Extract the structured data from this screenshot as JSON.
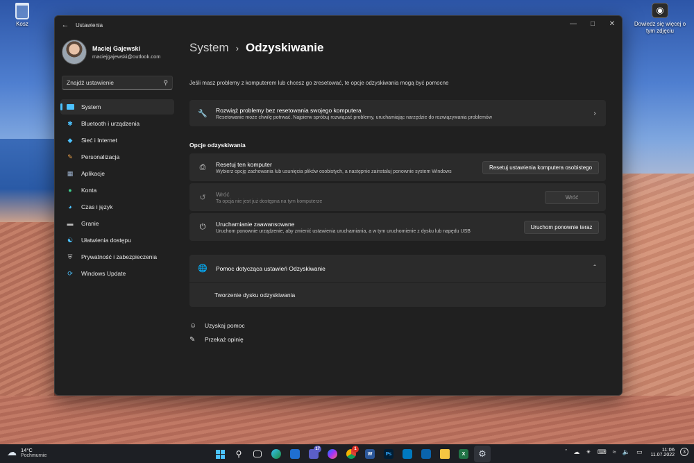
{
  "desktop": {
    "recycle_bin_label": "Kosz",
    "camera_widget_text": "Dowiedz się więcej o tym zdjęciu"
  },
  "window": {
    "title": "Ustawienia"
  },
  "profile": {
    "name": "Maciej Gajewski",
    "email": "maciejgajewski@outlook.com"
  },
  "search": {
    "placeholder": "Znajdź ustawienie"
  },
  "nav": {
    "items": [
      {
        "label": "System",
        "icon": "monitor-icon",
        "color": "#4cc2ff"
      },
      {
        "label": "Bluetooth i urządzenia",
        "icon": "bluetooth-icon",
        "color": "#4cc2ff"
      },
      {
        "label": "Sieć i Internet",
        "icon": "wifi-icon",
        "color": "#4cc2ff"
      },
      {
        "label": "Personalizacja",
        "icon": "brush-icon",
        "color": "#f0a34a"
      },
      {
        "label": "Aplikacje",
        "icon": "apps-icon",
        "color": "#9fb4d0"
      },
      {
        "label": "Konta",
        "icon": "person-icon",
        "color": "#3fcf8e"
      },
      {
        "label": "Czas i język",
        "icon": "globe-clock-icon",
        "color": "#4cc2ff"
      },
      {
        "label": "Granie",
        "icon": "gamepad-icon",
        "color": "#bdbdbd"
      },
      {
        "label": "Ułatwienia dostępu",
        "icon": "accessibility-icon",
        "color": "#4cc2ff"
      },
      {
        "label": "Prywatność i zabezpieczenia",
        "icon": "shield-icon",
        "color": "#bdbdbd"
      },
      {
        "label": "Windows Update",
        "icon": "update-icon",
        "color": "#4cc2ff"
      }
    ]
  },
  "content": {
    "breadcrumb_parent": "System",
    "breadcrumb_current": "Odzyskiwanie",
    "subtitle": "Jeśli masz problemy z komputerem lub chcesz go zresetować, te opcje odzyskiwania mogą być pomocne",
    "troubleshoot": {
      "title": "Rozwiąż problemy bez resetowania swojego komputera",
      "desc": "Resetowanie może chwilę potrwać. Najpierw spróbuj rozwiązać problemy, uruchamiając narzędzie do rozwiązywania problemów"
    },
    "section_title": "Opcje odzyskiwania",
    "options": [
      {
        "title": "Resetuj ten komputer",
        "desc": "Wybierz opcję zachowania lub usunięcia plików osobistych, a następnie zainstaluj ponownie system Windows",
        "button": "Resetuj ustawienia komputera osobistego"
      },
      {
        "title": "Wróć",
        "desc": "Ta opcja nie jest już dostępna na tym komputerze",
        "button": "Wróć"
      },
      {
        "title": "Uruchamianie zaawansowane",
        "desc": "Uruchom ponownie urządzenie, aby zmienić ustawienia uruchamiania, a w tym uruchomienie z dysku lub napędu USB",
        "button": "Uruchom ponownie teraz"
      }
    ],
    "help": {
      "title": "Pomoc dotycząca ustawień Odzyskiwanie",
      "link": "Tworzenie dysku odzyskiwania"
    },
    "footer": {
      "get_help": "Uzyskaj pomoc",
      "feedback": "Przekaż opinię"
    }
  },
  "taskbar": {
    "weather_temp": "14°C",
    "weather_desc": "Pochmurnie",
    "teams_badge": "17",
    "chrome_badge": "1",
    "time": "11:06",
    "date": "11.07.2022",
    "notifications": "3"
  }
}
